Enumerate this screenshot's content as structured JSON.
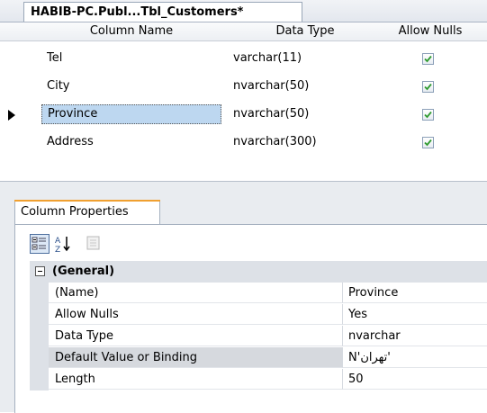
{
  "document_tab": {
    "title": "HABIB-PC.Publ...Tbl_Customers*"
  },
  "grid": {
    "headers": {
      "column_name": "Column Name",
      "data_type": "Data Type",
      "allow_nulls": "Allow Nulls"
    },
    "rows": [
      {
        "name": "Tel",
        "type": "varchar(11)",
        "allow_nulls": true
      },
      {
        "name": "City",
        "type": "nvarchar(50)",
        "allow_nulls": true
      },
      {
        "name": "Province",
        "type": "nvarchar(50)",
        "allow_nulls": true,
        "selected": true
      },
      {
        "name": "Address",
        "type": "nvarchar(300)",
        "allow_nulls": true
      }
    ]
  },
  "properties_panel": {
    "tab_label": "Column Properties",
    "toolbar": [
      "categorized-icon",
      "sort-alphabetical-icon",
      "property-pages-icon"
    ],
    "group": {
      "title": "(General)"
    },
    "items": [
      {
        "name": "(Name)",
        "value": "Province"
      },
      {
        "name": "Allow Nulls",
        "value": "Yes"
      },
      {
        "name": "Data Type",
        "value": "nvarchar"
      },
      {
        "name": "Default Value or Binding",
        "value": "N'تهران'",
        "selected": true
      },
      {
        "name": "Length",
        "value": "50"
      }
    ]
  },
  "colors": {
    "selection": "#bdd7f0",
    "tab_accent": "#f0a030",
    "checkmark": "#2f9a2f"
  }
}
